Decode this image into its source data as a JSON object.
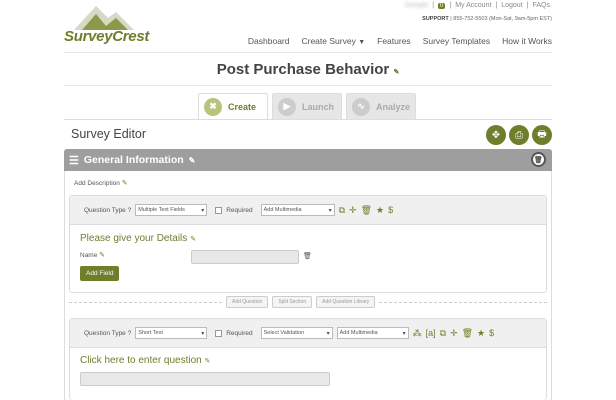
{
  "logo": {
    "text": "SurveyCrest"
  },
  "toplinks": {
    "username": "Sample",
    "badge": "0",
    "my_account": "My Account",
    "logout": "Logout",
    "faqs": "FAQs",
    "sep": "|"
  },
  "support": {
    "label": "SUPPORT",
    "text": "| 855-752-5503 (Mon-Sat, 9am-5pm EST)"
  },
  "nav": [
    "Dashboard",
    "Create Survey",
    "Features",
    "Survey Templates",
    "How it Works"
  ],
  "page_title": "Post Purchase Behavior",
  "tabs": [
    {
      "label": "Create"
    },
    {
      "label": "Launch"
    },
    {
      "label": "Analyze"
    }
  ],
  "editor_title": "Survey Editor",
  "section": {
    "title": "General Information",
    "add_description": "Add Description"
  },
  "q1": {
    "type_label": "Question Type ?",
    "type_value": "Multiple Text Fields",
    "required_label": "Required",
    "multimedia_value": "Add Multimedia",
    "title": "Please give your Details",
    "field_label": "Name",
    "add_field": "Add Field"
  },
  "divider_buttons": [
    "Add Question",
    "Split Section",
    "Add Question Library"
  ],
  "q2": {
    "type_label": "Question Type ?",
    "type_value": "Short Text",
    "required_label": "Required",
    "validation_value": "Select Validation",
    "multimedia_value": "Add Multimedia",
    "title": "Click here to enter question"
  },
  "colors": {
    "accent": "#6d7f2b",
    "header_bar": "#9e9e9e"
  }
}
